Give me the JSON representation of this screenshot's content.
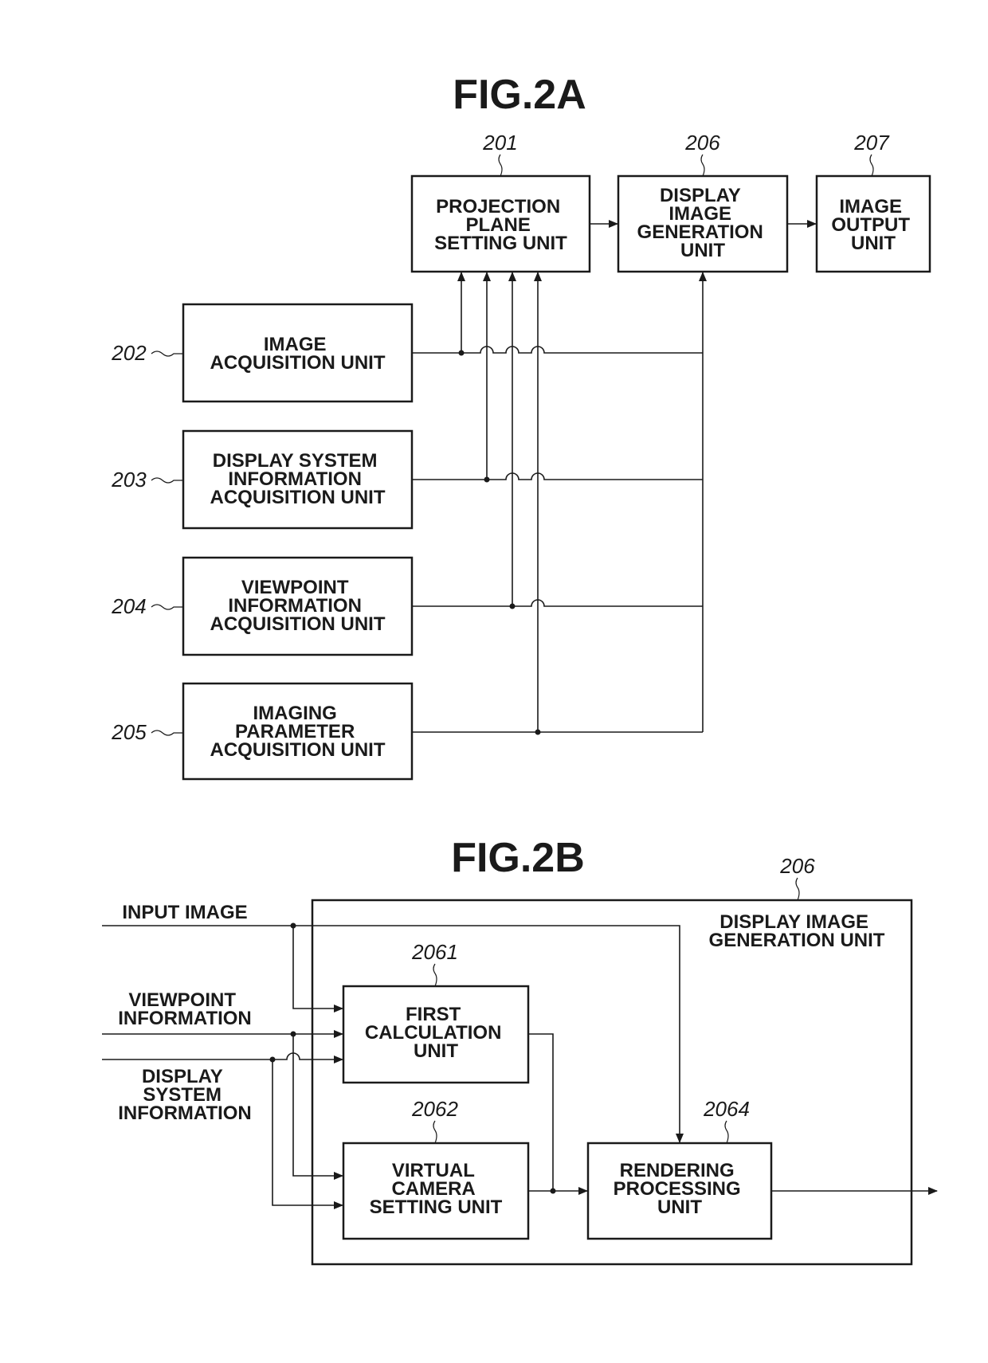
{
  "fig2a": {
    "title": "FIG.2A",
    "blocks": {
      "b201": {
        "ref": "201",
        "lines": [
          "PROJECTION",
          "PLANE",
          "SETTING UNIT"
        ]
      },
      "b206": {
        "ref": "206",
        "lines": [
          "DISPLAY",
          "IMAGE",
          "GENERATION",
          "UNIT"
        ]
      },
      "b207": {
        "ref": "207",
        "lines": [
          "IMAGE",
          "OUTPUT",
          "UNIT"
        ]
      },
      "b202": {
        "ref": "202",
        "lines": [
          "IMAGE",
          "ACQUISITION UNIT"
        ]
      },
      "b203": {
        "ref": "203",
        "lines": [
          "DISPLAY SYSTEM",
          "INFORMATION",
          "ACQUISITION UNIT"
        ]
      },
      "b204": {
        "ref": "204",
        "lines": [
          "VIEWPOINT",
          "INFORMATION",
          "ACQUISITION UNIT"
        ]
      },
      "b205": {
        "ref": "205",
        "lines": [
          "IMAGING",
          "PARAMETER",
          "ACQUISITION UNIT"
        ]
      }
    }
  },
  "fig2b": {
    "title": "FIG.2B",
    "container": {
      "ref": "206",
      "lines": [
        "DISPLAY IMAGE",
        "GENERATION UNIT"
      ]
    },
    "inputs": {
      "input_image": [
        "INPUT IMAGE"
      ],
      "viewpoint": [
        "VIEWPOINT",
        "INFORMATION"
      ],
      "display_system": [
        "DISPLAY",
        "SYSTEM",
        "INFORMATION"
      ]
    },
    "blocks": {
      "b2061": {
        "ref": "2061",
        "lines": [
          "FIRST",
          "CALCULATION",
          "UNIT"
        ]
      },
      "b2062": {
        "ref": "2062",
        "lines": [
          "VIRTUAL",
          "CAMERA",
          "SETTING UNIT"
        ]
      },
      "b2064": {
        "ref": "2064",
        "lines": [
          "RENDERING",
          "PROCESSING",
          "UNIT"
        ]
      }
    }
  }
}
